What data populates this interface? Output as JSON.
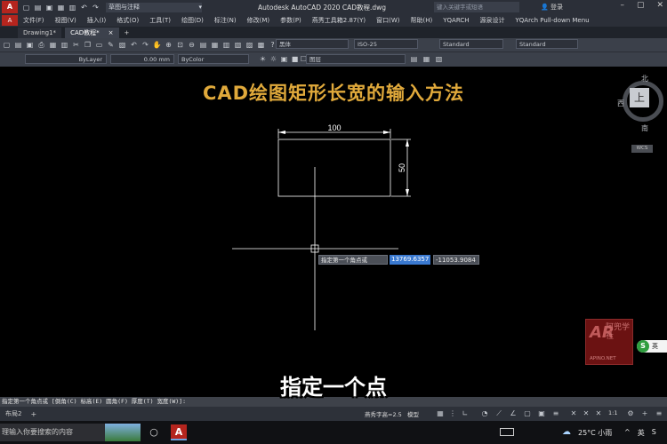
{
  "titlebar": {
    "logo": "A",
    "workspace": "草图与注释",
    "app_title": "Autodesk AutoCAD 2020    CAD教程.dwg",
    "search_placeholder": "键入关键字或短语",
    "login": "登录"
  },
  "menubar": {
    "logo": "A",
    "items": [
      "文件(F)",
      "视图(V)",
      "插入(I)",
      "格式(O)",
      "工具(T)",
      "绘图(D)",
      "标注(N)",
      "修改(M)",
      "参数(P)",
      "燕秀工具箱2.87(Y)",
      "窗口(W)",
      "帮助(H)",
      "YQARCH",
      "源泉设计",
      "YQArch Pull-down Menu"
    ]
  },
  "tabs": {
    "file1": "Drawing1*",
    "file2": "CAD教程*",
    "close": "×",
    "plus": "+"
  },
  "toolbar": {
    "linetype": "ByLayer",
    "lineweight": "0.00 mm",
    "color": "ByColor",
    "layer": "图层",
    "textstyle": "黑体",
    "dimstyle": "ISO-25",
    "tablestyle": "Standard",
    "mleaderstyle": "Standard"
  },
  "canvas": {
    "heading": "CAD绘图矩形长宽的输入方法",
    "dim_width": "100",
    "dim_height": "50",
    "dynamic_prompt": "指定第一个角点或",
    "dynamic_x": "13769.6357",
    "dynamic_y": "-11053.9084"
  },
  "viewcube": {
    "north": "北",
    "west": "西",
    "south": "南",
    "top": "上",
    "wcs": "WCS"
  },
  "watermark": {
    "logo": "AR",
    "cjk": "阿兜学社",
    "url": "APINO.NET"
  },
  "ime": {
    "icon": "S",
    "lang": "英"
  },
  "subtitle": "指定一个点",
  "command_line": "指定第一个角点或 [倒角(C) 标高(E) 圆角(F) 厚度(T) 宽度(W)]:",
  "statusbar": {
    "layout_tab": "布局2",
    "plus": "+",
    "scale": "燕秀字高=2.5",
    "model": "模型",
    "zoom": "1:1"
  },
  "taskbar": {
    "search": "理输入你要搜索的内容",
    "acad": "A",
    "weather": "25°C 小雨",
    "tray_lang": "英",
    "tray_s": "S"
  }
}
